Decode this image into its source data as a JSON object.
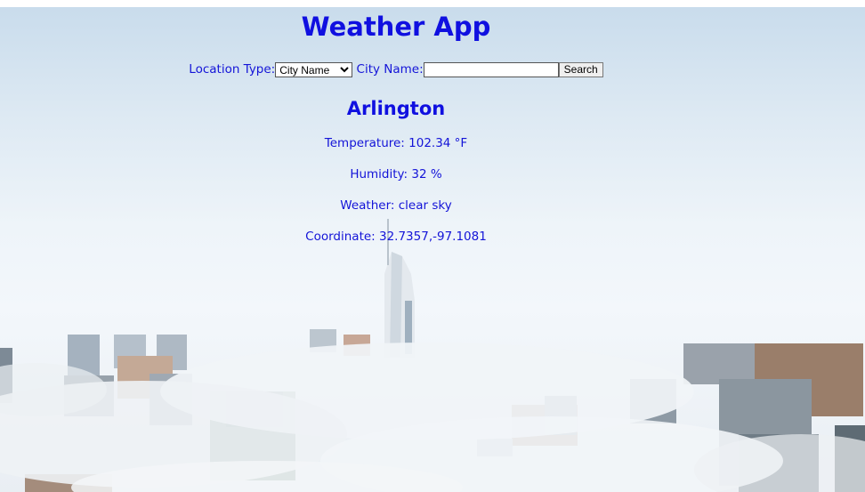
{
  "app": {
    "title": "Weather App"
  },
  "search": {
    "location_type_label": "Location Type:",
    "location_type_selected": "City Name",
    "city_name_label": "City Name:",
    "city_name_value": "",
    "search_button": "Search"
  },
  "result": {
    "city": "Arlington",
    "temperature": "Temperature: 102.34 °F",
    "humidity": "Humidity: 32 %",
    "weather": "Weather: clear sky",
    "coordinate": "Coordinate: 32.7357,-97.1081"
  },
  "colors": {
    "text_blue": "#1414d8",
    "heading_blue": "#1010e0"
  }
}
